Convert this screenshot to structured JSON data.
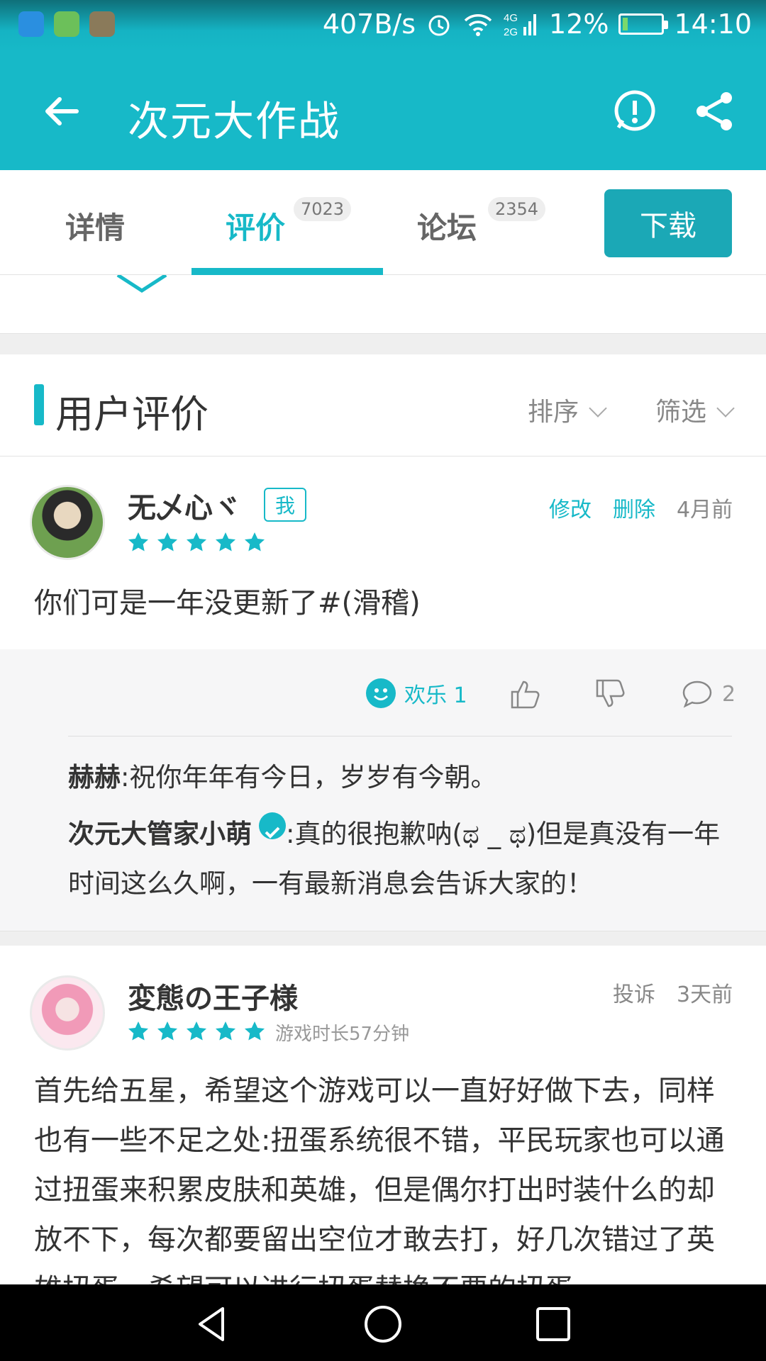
{
  "status_bar": {
    "net_speed": "407B/s",
    "network": "4G 2G",
    "battery": "12%",
    "battery_level": 0.12,
    "time": "14:10"
  },
  "app_bar": {
    "title": "次元大作战",
    "back_icon": "arrow-left-icon",
    "report_icon": "exclamation-circle-icon",
    "share_icon": "share-icon"
  },
  "tabs": {
    "items": [
      {
        "label": "详情",
        "badge": ""
      },
      {
        "label": "评价",
        "badge": "7023"
      },
      {
        "label": "论坛",
        "badge": "2354"
      }
    ],
    "active_index": 1,
    "download_label": "下载"
  },
  "section": {
    "title": "用户评价",
    "sort_label": "排序",
    "filter_label": "筛选"
  },
  "reviews": [
    {
      "username": "无乄心ヾ",
      "me_badge": "我",
      "edit_label": "修改",
      "delete_label": "删除",
      "time": "4月前",
      "stars": 5,
      "text": "你们可是一年没更新了#(滑稽)",
      "joy_label": "欢乐 1",
      "comment_count": "2",
      "replies": [
        {
          "author": "赫赫",
          "text": ":祝你年年有今日，岁岁有今朝。"
        },
        {
          "author": "次元大管家小萌",
          "verified": true,
          "text": ":真的很抱歉呐(ಥ _ ಥ)但是真没有一年时间这么久啊，一有最新消息会告诉大家的！"
        }
      ]
    },
    {
      "username": "変態の王子様",
      "report_label": "投诉",
      "time": "3天前",
      "stars": 5,
      "playtime": "游戏时长57分钟",
      "text": "首先给五星，希望这个游戏可以一直好好做下去，同样也有一些不足之处:扭蛋系统很不错，平民玩家也可以通过扭蛋来积累皮肤和英雄，但是偶尔打出时装什么的却放不下，每次都要留出空位才敢去打，好几次错过了英雄扭蛋，希望可以进行扭蛋替换不要的扭蛋"
    }
  ],
  "colors": {
    "accent": "#17b9c8",
    "download": "#1ba8b6"
  }
}
